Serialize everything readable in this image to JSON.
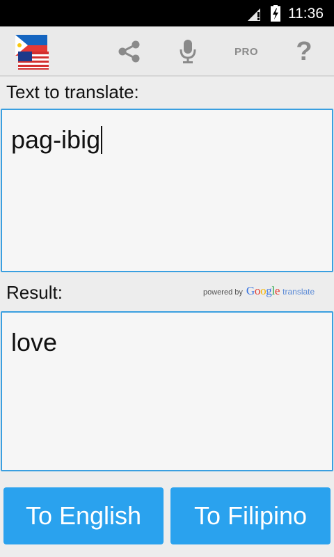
{
  "status_bar": {
    "time": "11:36",
    "icons": [
      "signal-icon",
      "battery-charging-icon"
    ]
  },
  "action_bar": {
    "app_icon": "flags-ph-us-icon",
    "share_icon": "share-icon",
    "mic_icon": "microphone-icon",
    "pro_label": "PRO",
    "help_label": "?"
  },
  "source": {
    "label": "Text to translate:",
    "value": "pag-ibig"
  },
  "result": {
    "label": "Result:",
    "value": "love",
    "powered_by": "powered by",
    "google": "Google",
    "translate": "translate"
  },
  "buttons": {
    "to_english": "To English",
    "to_filipino": "To Filipino"
  },
  "colors": {
    "accent": "#2aa2ee",
    "field_border": "#3a9fe0"
  }
}
